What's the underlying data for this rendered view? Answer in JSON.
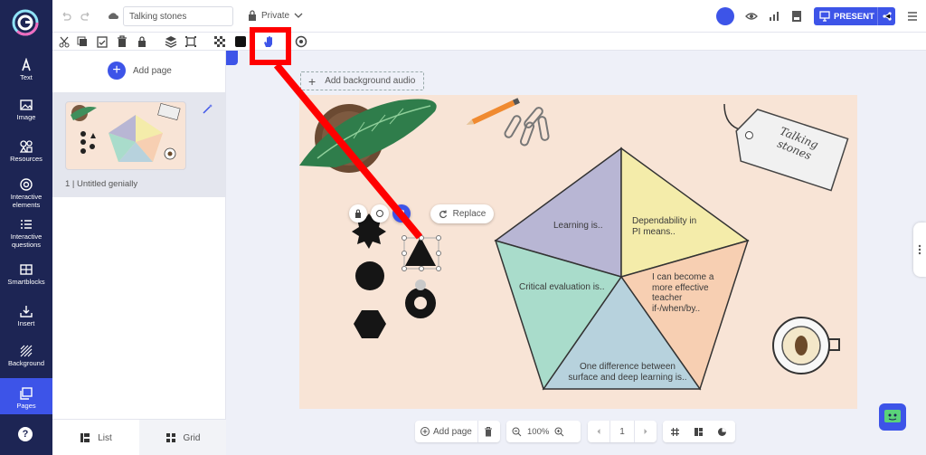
{
  "left_nav": {
    "items": [
      {
        "label": "Text",
        "icon": "text-icon"
      },
      {
        "label": "Image",
        "icon": "image-icon"
      },
      {
        "label": "Resources",
        "icon": "resources-icon"
      },
      {
        "label": "Interactive elements",
        "icon": "interactive-elements-icon"
      },
      {
        "label": "Interactive questions",
        "icon": "interactive-questions-icon"
      },
      {
        "label": "Smartblocks",
        "icon": "smartblocks-icon"
      },
      {
        "label": "Insert",
        "icon": "insert-icon"
      },
      {
        "label": "Background",
        "icon": "background-icon"
      },
      {
        "label": "Pages",
        "icon": "pages-icon",
        "active": true
      }
    ],
    "help_label": "?"
  },
  "top_bar": {
    "title_value": "Talking stones",
    "privacy_label": "Private",
    "present_label": "PRESENT"
  },
  "pages_panel": {
    "add_page_label": "Add page",
    "page_item_label": "1 |  Untitled genially",
    "tabs": {
      "list": "List",
      "grid": "Grid"
    }
  },
  "canvas": {
    "bg_audio_label": "Add background audio",
    "replace_label": "Replace",
    "tag_text": "Talking stones",
    "slices": {
      "s1": "Learning is..",
      "s2": "Dependability in PI means..",
      "s3": "I can become a more effective teacher if-/when/by..",
      "s4": "One difference between surface and deep learning is..",
      "s5": "Critical evaluation is.."
    }
  },
  "bottom_bar": {
    "add_page_label": "Add page",
    "zoom_value": "100%",
    "page_number": "1"
  },
  "colors": {
    "nav_bg": "#1d2554",
    "accent": "#3d54e8",
    "slide_bg": "#f8e4d6",
    "highlight": "#ff0000",
    "slice_purple": "#b8b6d4",
    "slice_yellow": "#f4ecaa",
    "slice_peach": "#f7cfb2",
    "slice_blue": "#b7d2dd",
    "slice_teal": "#a9dccb"
  }
}
